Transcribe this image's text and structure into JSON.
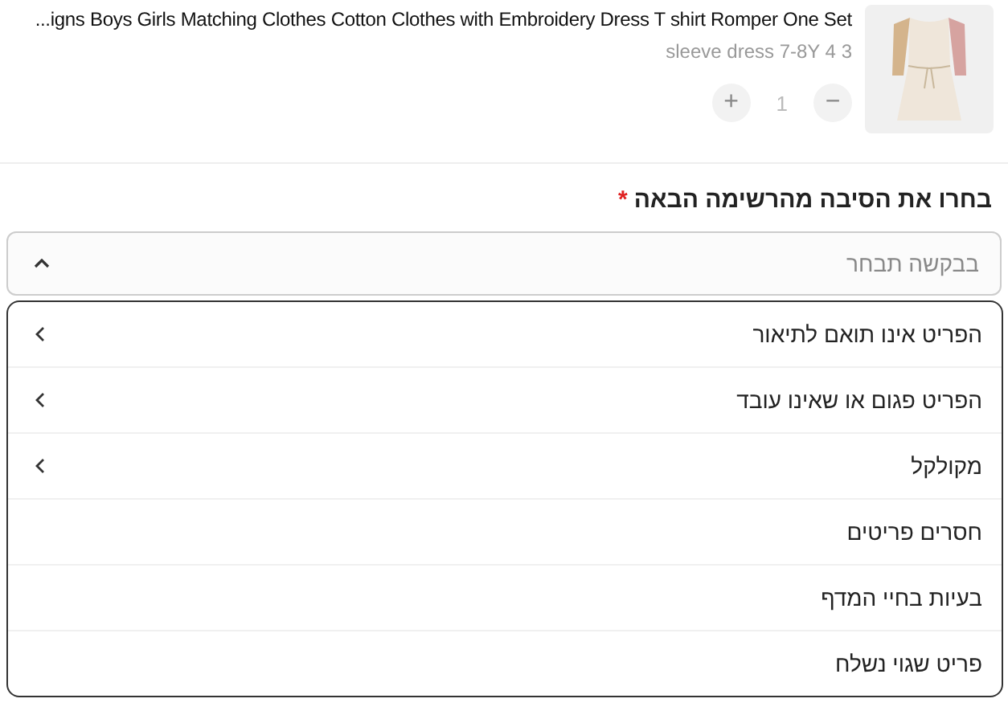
{
  "product": {
    "title": "...igns Boys Girls Matching Clothes Cotton Clothes with Embroidery Dress T shirt Romper One Set",
    "variant": "sleeve dress 7-8Y 4 3",
    "quantity": {
      "value": "1",
      "plus_label": "+",
      "minus_label": "−",
      "disabled": true
    }
  },
  "reason_select": {
    "label": "בחרו את הסיבה מהרשימה הבאה",
    "required_mark": "*",
    "placeholder": "בבקשה תבחר",
    "expanded": true,
    "options": [
      {
        "label": "הפריט אינו תואם לתיאור",
        "has_submenu": true
      },
      {
        "label": "הפריט פגום או שאינו עובד",
        "has_submenu": true
      },
      {
        "label": "מקולקל",
        "has_submenu": true
      },
      {
        "label": "חסרים פריטים",
        "has_submenu": false
      },
      {
        "label": "בעיות בחיי המדף",
        "has_submenu": false
      },
      {
        "label": "פריט שגוי נשלח",
        "has_submenu": false
      }
    ]
  }
}
